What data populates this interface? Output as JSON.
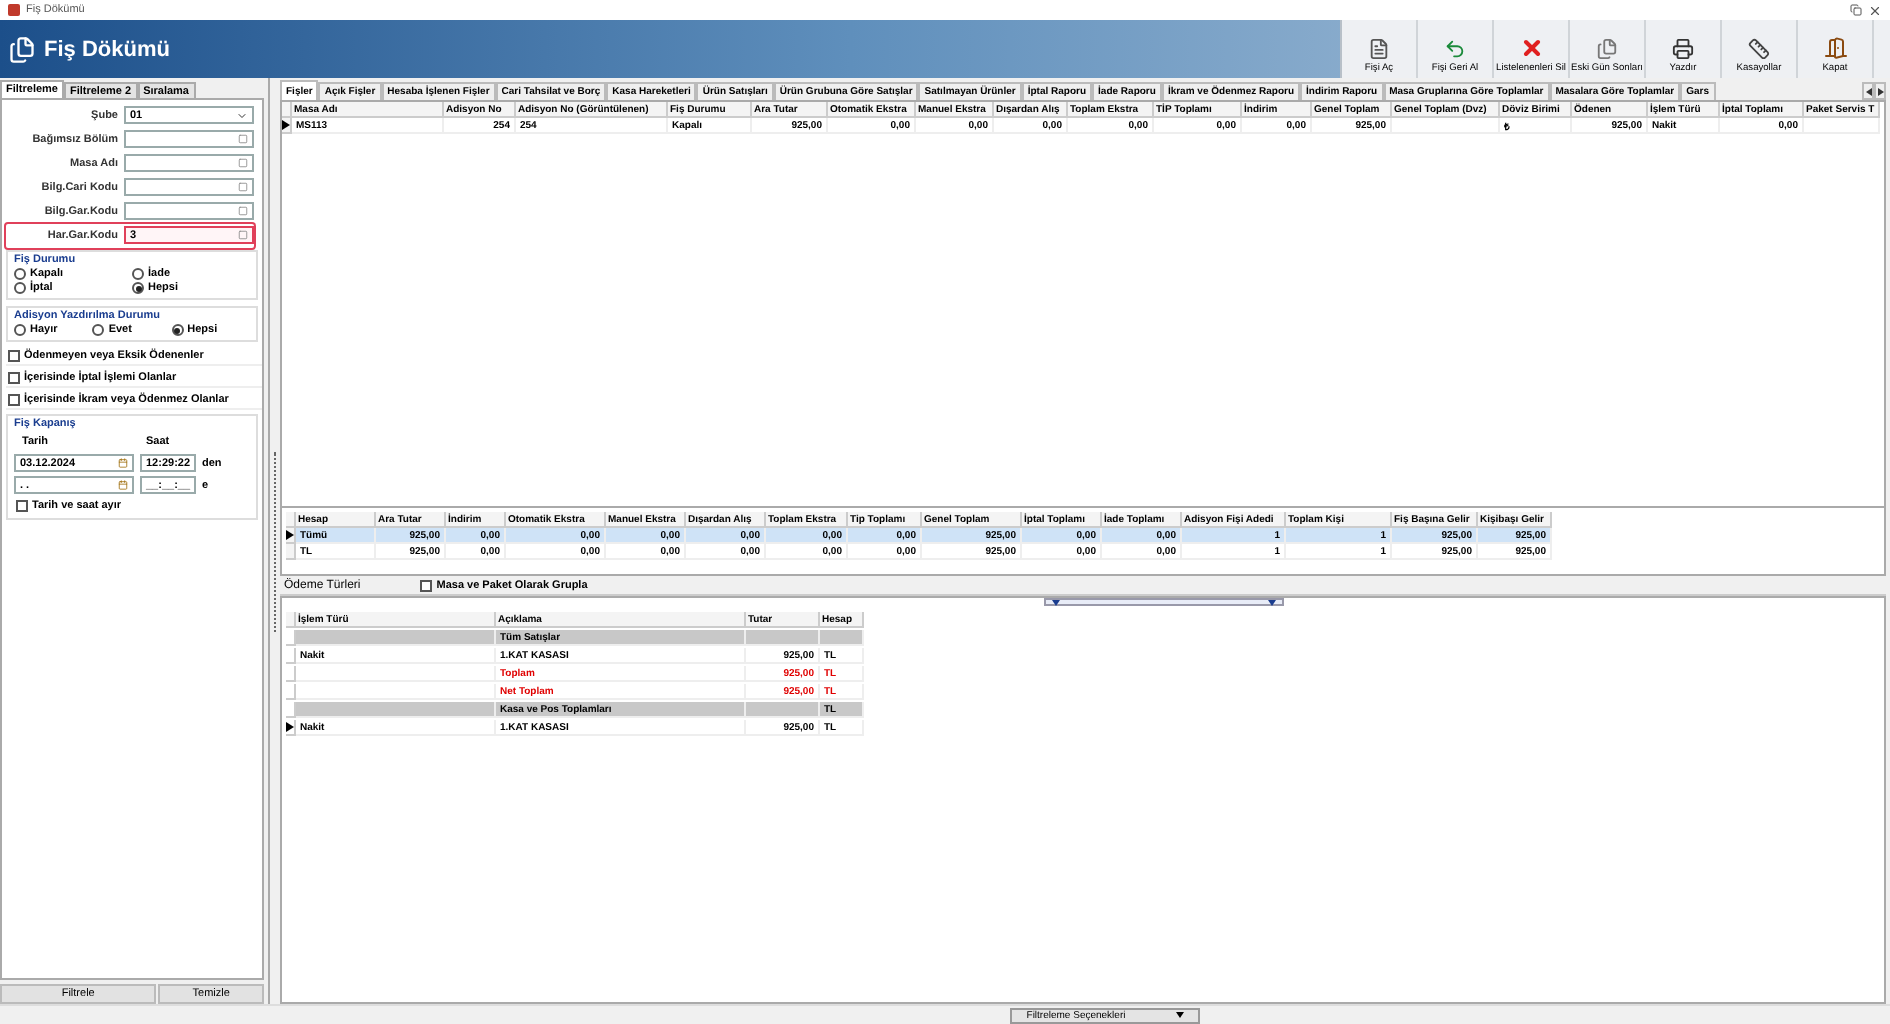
{
  "window": {
    "title": "Fiş Dökümü"
  },
  "header": {
    "title": "Fiş Dökümü"
  },
  "toolbar": [
    {
      "label": "Fişi Aç",
      "kind": "open"
    },
    {
      "label": "Fişi Geri Al",
      "kind": "undo"
    },
    {
      "label": "Listelenenleri Sil",
      "kind": "delete"
    },
    {
      "label": "Eski Gün Sonları",
      "kind": "archive"
    },
    {
      "label": "Yazdır",
      "kind": "print"
    },
    {
      "label": "Kasayollar",
      "kind": "bar"
    },
    {
      "label": "Kapat",
      "kind": "exit"
    }
  ],
  "filter_tabs": [
    {
      "label": "Filtreleme",
      "selected": true
    },
    {
      "label": "Filtreleme 2",
      "selected": false
    },
    {
      "label": "Sıralama",
      "selected": false
    }
  ],
  "filter_fields": [
    {
      "label": "Şube",
      "value": "01",
      "kind": "dropdown",
      "highlighted": false
    },
    {
      "label": "Bağımsız Bölüm",
      "kind": "lookup",
      "highlighted": false
    },
    {
      "label": "Masa Adı",
      "kind": "lookup",
      "highlighted": false
    },
    {
      "label": "Bilg.Cari Kodu",
      "kind": "lookup",
      "highlighted": false
    },
    {
      "label": "Bilg.Gar.Kodu",
      "kind": "lookup",
      "highlighted": false
    },
    {
      "label": "Har.Gar.Kodu",
      "value": "3",
      "kind": "lookup",
      "highlighted": true
    }
  ],
  "receipt_status": {
    "title": "Fiş Durumu",
    "options": [
      {
        "label": "Kapalı",
        "selected": false
      },
      {
        "label": "İade",
        "selected": false
      },
      {
        "label": "İptal",
        "selected": false
      },
      {
        "label": "Hepsi",
        "selected": true
      }
    ]
  },
  "print_status": {
    "title": "Adisyon Yazdırılma Durumu",
    "options": [
      {
        "label": "Hayır",
        "selected": false
      },
      {
        "label": "Evet",
        "selected": false
      },
      {
        "label": "Hepsi",
        "selected": true
      }
    ]
  },
  "checkboxes": [
    {
      "label": "Ödenmeyen veya Eksik Ödenenler",
      "checked": false
    },
    {
      "label": "İçerisinde İptal İşlemi Olanlar",
      "checked": false
    },
    {
      "label": "İçerisinde İkram veya Ödenmez Olanlar",
      "checked": false
    }
  ],
  "closing": {
    "title": "Fiş Kapanış",
    "date_label": "Tarih",
    "time_label": "Saat",
    "rows": [
      {
        "date": "03.12.2024",
        "time": "12:29:22",
        "suffix": "den"
      },
      {
        "date": ". .",
        "time": "__:__:__",
        "suffix": "e"
      }
    ],
    "separate": {
      "label": "Tarih ve saat ayır",
      "checked": false
    }
  },
  "filter_buttons": [
    "Filtrele",
    "Temizle"
  ],
  "report_tabs": [
    {
      "label": "Fişler",
      "selected": true
    },
    {
      "label": "Açık Fişler",
      "selected": false
    },
    {
      "label": "Hesaba İşlenen Fişler",
      "selected": false
    },
    {
      "label": "Cari Tahsilat ve Borç",
      "selected": false
    },
    {
      "label": "Kasa Hareketleri",
      "selected": false
    },
    {
      "label": "Ürün Satışları",
      "selected": false
    },
    {
      "label": "Ürün Grubuna Göre Satışlar",
      "selected": false
    },
    {
      "label": "Satılmayan Ürünler",
      "selected": false
    },
    {
      "label": "İptal Raporu",
      "selected": false
    },
    {
      "label": "İade Raporu",
      "selected": false
    },
    {
      "label": "İkram ve Ödenmez Raporu",
      "selected": false
    },
    {
      "label": "İndirim Raporu",
      "selected": false
    },
    {
      "label": "Masa Gruplarına Göre Toplamlar",
      "selected": false
    },
    {
      "label": "Masalara Göre Toplamlar",
      "selected": false
    },
    {
      "label": "Gars",
      "selected": false
    }
  ],
  "receipts": {
    "columns": [
      "Masa Adı",
      "Adisyon No",
      "Adisyon No (Görüntülenen)",
      "Fiş Durumu",
      "Ara Tutar",
      "Otomatik Ekstra",
      "Manuel Ekstra",
      "Dışardan Alış",
      "Toplam Ekstra",
      "TİP Toplamı",
      "İndirim",
      "Genel Toplam",
      "Genel Toplam (Dvz)",
      "Döviz Birimi",
      "Ödenen",
      "İşlem Türü",
      "İptal Toplamı",
      "Paket Servis T"
    ],
    "rows": [
      {
        "current": true,
        "cells": [
          "MS113",
          "254",
          "254",
          "Kapalı",
          "925,00",
          "0,00",
          "0,00",
          "0,00",
          "0,00",
          "0,00",
          "0,00",
          "925,00",
          "",
          "₺",
          "925,00",
          "Nakit",
          "0,00",
          ""
        ]
      }
    ]
  },
  "summary": {
    "columns": [
      "Hesap",
      "Ara Tutar",
      "İndirim",
      "Otomatik Ekstra",
      "Manuel Ekstra",
      "Dışardan Alış",
      "Toplam Ekstra",
      "Tip Toplamı",
      "Genel Toplam",
      "İptal Toplamı",
      "İade Toplamı",
      "Adisyon Fişi Adedi",
      "Toplam Kişi",
      "Fiş Başına Gelir",
      "Kişibaşı Gelir"
    ],
    "rows": [
      {
        "selected": true,
        "cells": [
          "Tümü",
          "925,00",
          "0,00",
          "0,00",
          "0,00",
          "0,00",
          "0,00",
          "0,00",
          "925,00",
          "0,00",
          "0,00",
          "1",
          "1",
          "925,00",
          "925,00"
        ]
      },
      {
        "selected": false,
        "cells": [
          "TL",
          "925,00",
          "0,00",
          "0,00",
          "0,00",
          "0,00",
          "0,00",
          "0,00",
          "925,00",
          "0,00",
          "0,00",
          "1",
          "1",
          "925,00",
          "925,00"
        ]
      }
    ]
  },
  "payment_options": {
    "label": "Ödeme Türleri",
    "group": {
      "label": "Masa ve Paket Olarak Grupla",
      "checked": false
    }
  },
  "payments": {
    "columns": [
      "İşlem Türü",
      "Açıklama",
      "Tutar",
      "Hesap"
    ],
    "rows": [
      {
        "kind": "group",
        "cells": [
          "",
          "Tüm Satışlar",
          "",
          ""
        ],
        "current": false
      },
      {
        "kind": "normal",
        "cells": [
          "Nakit",
          "1.KAT KASASI",
          "925,00",
          "TL"
        ],
        "current": false
      },
      {
        "kind": "total",
        "cells": [
          "",
          "Toplam",
          "925,00",
          "TL"
        ],
        "current": false
      },
      {
        "kind": "total",
        "cells": [
          "",
          "Net Toplam",
          "925,00",
          "TL"
        ],
        "current": false
      },
      {
        "kind": "group",
        "cells": [
          "",
          "Kasa ve Pos Toplamları",
          "",
          "TL"
        ],
        "current": false
      },
      {
        "kind": "normal",
        "cells": [
          "Nakit",
          "1.KAT KASASI",
          "925,00",
          "TL"
        ],
        "current": true
      }
    ]
  },
  "status_bar": {
    "button": "Filtreleme Seçenekleri"
  }
}
